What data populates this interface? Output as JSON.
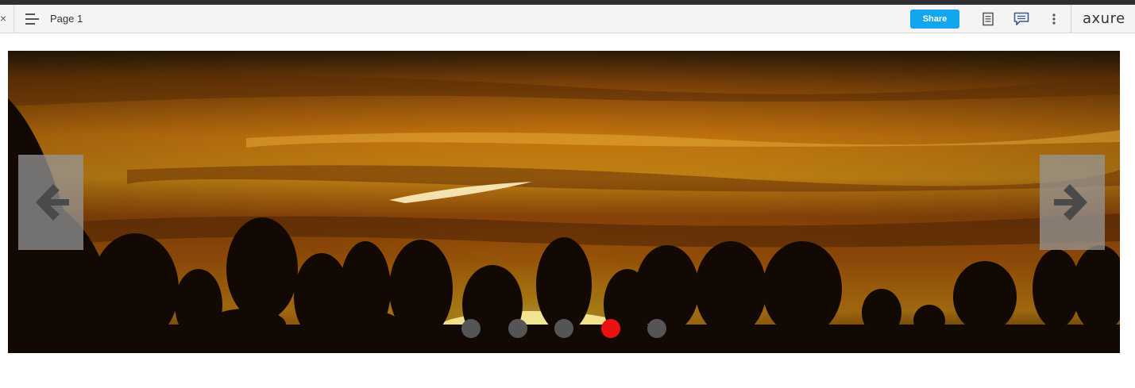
{
  "window": {
    "close_glyph": "×",
    "page_title": "Page 1"
  },
  "toolbar": {
    "share_label": "Share",
    "icons": [
      "menu-icon",
      "notes-icon",
      "comments-icon",
      "more-icon"
    ],
    "share_color": "#11a6ee"
  },
  "brand": {
    "logo_text": "axure"
  },
  "slider": {
    "image": "sunset-over-tree-silhouettes",
    "prev_icon": "arrow-left-icon",
    "next_icon": "arrow-right-icon",
    "dot_count": 5,
    "active_dot": 4,
    "dot_color": "#555555",
    "active_dot_color": "#ee1111"
  }
}
